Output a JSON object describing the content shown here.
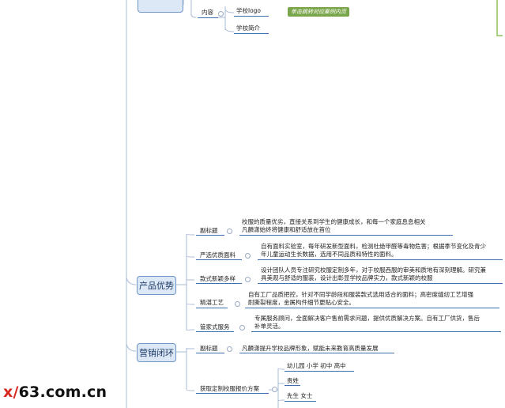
{
  "top": {
    "content_label": "内容",
    "items": [
      "学校logo",
      "学校简介"
    ],
    "tip": "单击跳转对应案例内页"
  },
  "advantage": {
    "title": "产品优势",
    "branches": [
      {
        "label": "副标题",
        "text": "校服的质量优劣，直接关系到学生的健康成长，和每一个家庭息息相关\n凡麟潇始终将健康和舒适放在首位"
      },
      {
        "label": "严选优质面料",
        "text": "自有面料实验室，每年研发新型面料，检测杜绝甲醛等毒物危害；根据季节变化及青少\n年儿童运动生长数据，选用不同品质和特性的面料。"
      },
      {
        "label": "款式新颖多样",
        "text": "设计团队人员专注研究校服定制多年，对于校服西服的审美和质地有深刻理解。研究兼\n具美观与舒适的服装，设计出彰显学校品牌实力，款式新颖的校服"
      },
      {
        "label": "精湛工艺",
        "text": "自有工厂品质把控，针对不同学龄段和服装款式选用适合的面料；高密度缝纫工艺增强\n耐撕裂程度，金属构件细节更贴心安全。"
      },
      {
        "label": "管家式服务",
        "text": "专属服务顾问，全面解决客户售前需求问题，提供优质解决方案。自有工厂供货，售后\n补单灵活。"
      }
    ]
  },
  "loop": {
    "title": "营销闭环",
    "subtitle_label": "副标题",
    "subtitle_text": "凡麟潇提升学校品牌形象，赋能未来教育高质量发展",
    "plan_label": "获取定制校服报价方案",
    "plan_items": [
      "幼儿园 小学 初中 高中",
      "贵姓",
      "先生 女士"
    ]
  },
  "watermark": {
    "part1": "x/",
    "part2": "63",
    "part3": ".com.cn"
  },
  "colors": {
    "line": "#aabbd4",
    "underline": "#3f6fb0",
    "tip": "#7aa64b",
    "node_fill": "#dde8f6",
    "node_border": "#6f95c6"
  }
}
